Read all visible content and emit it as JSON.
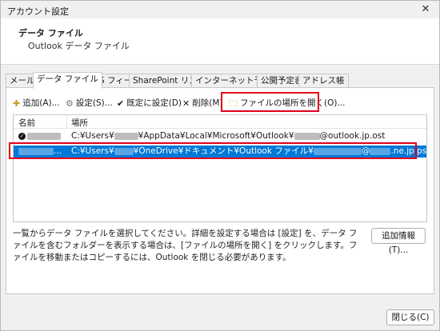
{
  "window": {
    "title": "アカウント設定",
    "close_glyph": "✕"
  },
  "header": {
    "title": "データ ファイル",
    "subtitle": "Outlook データ ファイル"
  },
  "tabs": [
    {
      "label": "メール"
    },
    {
      "label": "データ ファイル",
      "active": true
    },
    {
      "label": "RSS フィード"
    },
    {
      "label": "SharePoint リスト"
    },
    {
      "label": "インターネット予定表"
    },
    {
      "label": "公開予定表"
    },
    {
      "label": "アドレス帳"
    }
  ],
  "toolbar": {
    "add": "追加(A)...",
    "settings": "設定(S)...",
    "default": "既定に設定(D)",
    "delete": "削除(M)",
    "open_location": "ファイルの場所を開く(O)..."
  },
  "list": {
    "col_name": "名前",
    "col_location": "場所",
    "rows": [
      {
        "path_start": "C:¥Users¥",
        "path_mid": "¥AppData¥Local¥Microsoft¥Outlook¥",
        "path_end": "@outlook.jp.ost",
        "is_default": true,
        "selected": false
      },
      {
        "name_suffix": "...",
        "path_start": "C:¥Users¥",
        "path_mid": "¥OneDrive¥ドキュメント¥Outlook ファイル¥",
        "path_at": "@",
        "path_end": ".ne.jp.pst",
        "is_default": false,
        "selected": true
      }
    ]
  },
  "description": "一覧からデータ ファイルを選択してください。詳細を設定する場合は [設定] を、データ ファイルを含むフォルダーを表示する場合は、[ファイルの場所を開く] をクリックします。ファイルを移動またはコピーするには、Outlook を閉じる必要があります。",
  "more_info_button": "追加情報(T)...",
  "close_button": "閉じる(C)",
  "colors": {
    "highlight": "#e2001a",
    "selection": "#0078d7"
  }
}
